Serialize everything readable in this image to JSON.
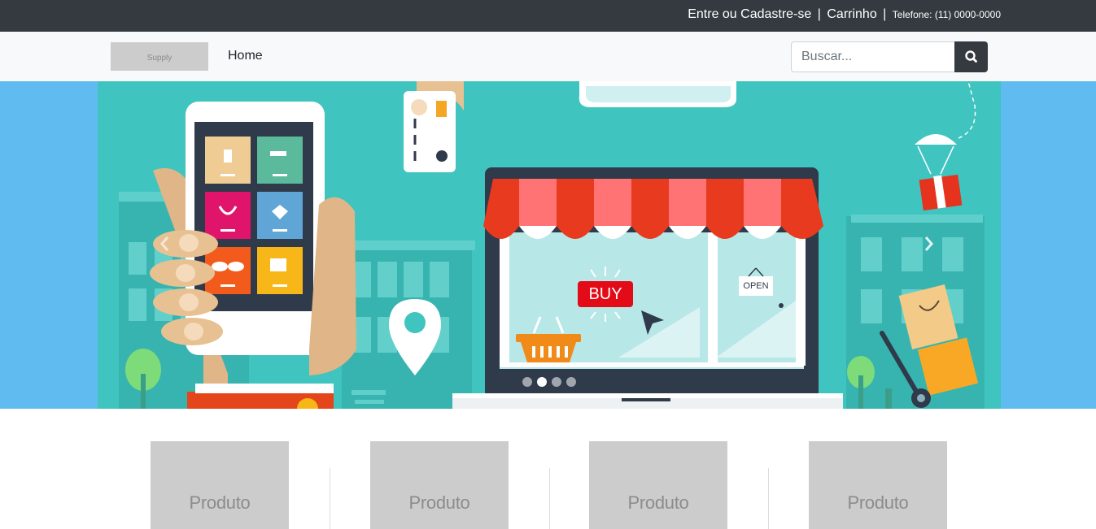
{
  "topbar": {
    "login_label": "Entre ou Cadastre-se",
    "cart_label": "Carrinho",
    "separator": "|",
    "phone_label": "Telefone: (11) 0000-0000"
  },
  "navbar": {
    "logo_text": "Supply",
    "home_label": "Home",
    "search_placeholder": "Buscar..."
  },
  "banner": {
    "buy_text": "BUY",
    "open_text": "OPEN",
    "slide_count": 4,
    "active_slide": 2
  },
  "products": [
    {
      "label": "Produto"
    },
    {
      "label": "Produto"
    },
    {
      "label": "Produto"
    },
    {
      "label": "Produto"
    }
  ],
  "colors": {
    "topbar_bg": "#343a40",
    "navbar_bg": "#f8f9fa",
    "hero_bg": "#60bcf0",
    "banner_bg": "#40c4c0",
    "placeholder_gray": "#cccccc"
  }
}
